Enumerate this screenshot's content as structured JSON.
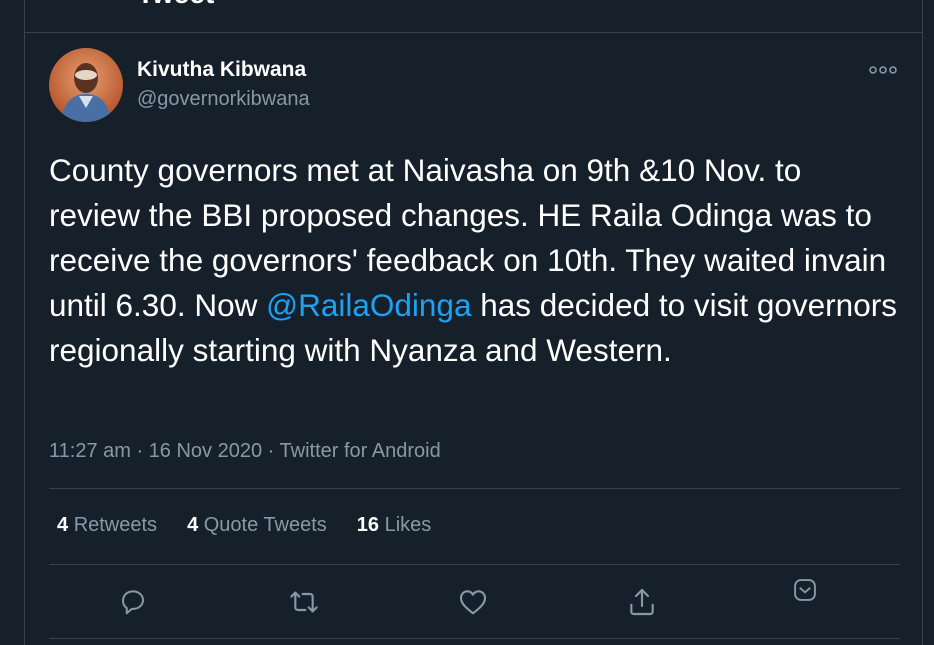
{
  "header": {
    "title": "Tweet"
  },
  "author": {
    "name": "Kivutha Kibwana",
    "handle": "@governorkibwana"
  },
  "tweet": {
    "text_part1": "County governors met at Naivasha on 9th &10 Nov. to review the BBI proposed changes. HE Raila Odinga was to receive the governors' feedback on 10th. They waited invain until 6.30. Now ",
    "mention": "@RailaOdinga",
    "text_part2": " has decided to visit governors  regionally starting with Nyanza and Western.",
    "time": "11:27 am",
    "date": "16 Nov 2020",
    "source": "Twitter for Android",
    "separator": " · "
  },
  "stats": {
    "retweets_count": "4",
    "retweets_label": "Retweets",
    "quote_count": "4",
    "quote_label": "Quote Tweets",
    "likes_count": "16",
    "likes_label": "Likes"
  },
  "actions": {
    "reply_icon": "reply-icon",
    "retweet_icon": "retweet-icon",
    "like_icon": "heart-icon",
    "share_icon": "share-icon",
    "more_icon": "chevron-down-icon"
  },
  "colors": {
    "background": "#15202b",
    "border": "#38444d",
    "secondary_text": "#8899a6",
    "accent": "#1da1f2"
  }
}
